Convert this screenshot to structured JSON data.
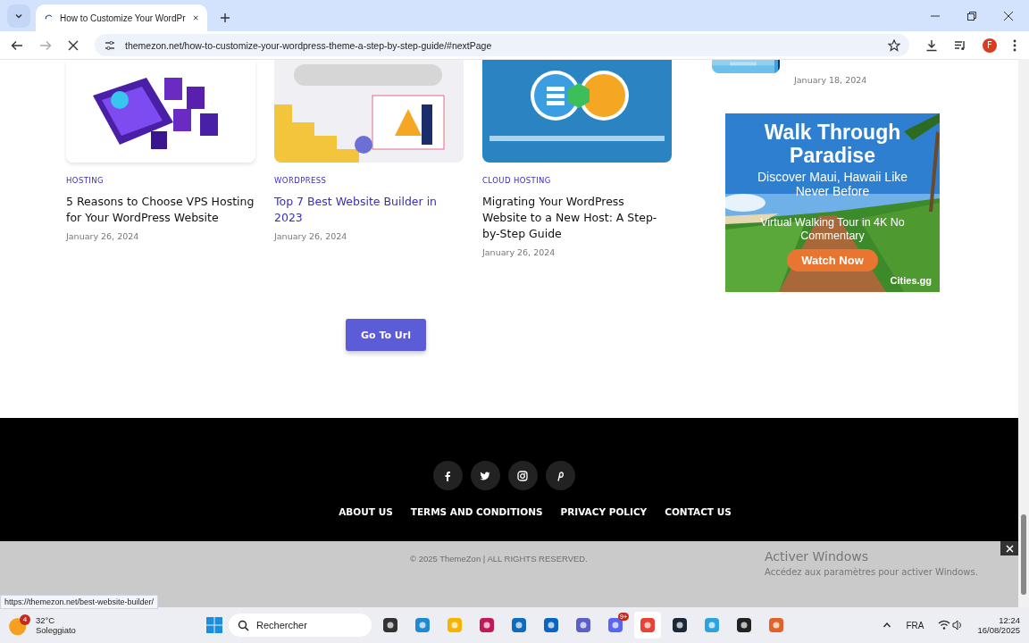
{
  "browser": {
    "tab_title": "How to Customize Your WordPr",
    "url": "themezon.net/how-to-customize-your-wordpress-theme-a-step-by-step-guide/#nextPage",
    "loading": true,
    "avatar": "F"
  },
  "posts": [
    {
      "category": "HOSTING",
      "title": "5 Reasons to Choose VPS Hosting for Your WordPress Website",
      "date": "January 26, 2024",
      "hovered": false,
      "kind": "picture"
    },
    {
      "category": "WORDPRESS",
      "title": "Top 7 Best Website Builder in 2023",
      "date": "January 26, 2024",
      "hovered": true,
      "kind": "picture"
    },
    {
      "category": "CLOUD HOSTING",
      "title": "Migrating Your WordPress Website to a New Host: A Step-by-Step Guide",
      "date": "January 26, 2024",
      "hovered": false,
      "kind": "picture"
    }
  ],
  "sidebar": {
    "date": "January 18, 2024"
  },
  "ad": {
    "headline": "Walk Through Paradise",
    "subline": "Discover Maui, Hawaii Like Never Before",
    "tagline": "Virtual Walking Tour in 4K No Commentary",
    "cta": "Watch Now",
    "brand": "Cities.gg"
  },
  "go_button": "Go To Url",
  "footer": {
    "social": [
      {
        "kind": "facebook"
      },
      {
        "kind": "twitter"
      },
      {
        "kind": "instagram"
      },
      {
        "kind": "pinterest"
      }
    ],
    "links": [
      "ABOUT US",
      "TERMS AND CONDITIONS",
      "PRIVACY POLICY",
      "CONTACT US"
    ]
  },
  "overlay": {
    "copyright": "© 2025 ThemeZon | ALL RIGHTS RESERVED."
  },
  "activation": {
    "title": "Activer Windows",
    "subtitle": "Accédez aux paramètres pour activer Windows."
  },
  "status_url": "https://themezon.net/best-website-builder/",
  "taskbar": {
    "weather_badge": "4",
    "temperature": "32°C",
    "condition": "Soleggiato",
    "search": "Rechercher",
    "apps": [
      {
        "kind": "taskview"
      },
      {
        "kind": "edge"
      },
      {
        "kind": "files"
      },
      {
        "kind": "media"
      },
      {
        "kind": "store"
      },
      {
        "kind": "outlook"
      },
      {
        "kind": "teams"
      },
      {
        "kind": "discord",
        "badge": "9+"
      },
      {
        "kind": "chrome",
        "active": true
      },
      {
        "kind": "steam"
      },
      {
        "kind": "telegram"
      },
      {
        "kind": "record"
      },
      {
        "kind": "mic"
      }
    ],
    "language": "FRA",
    "time": "12:24",
    "date": "16/08/2025"
  }
}
